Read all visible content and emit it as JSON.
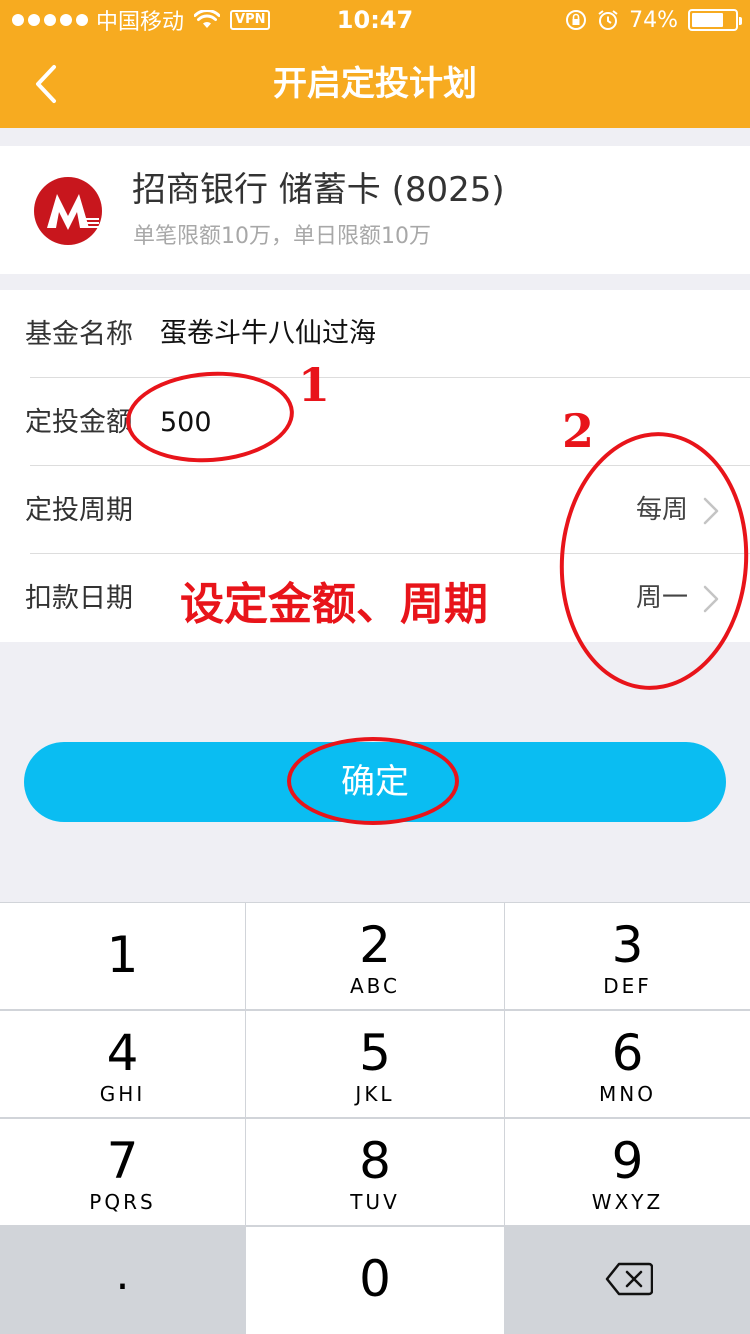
{
  "status_bar": {
    "carrier": "中国移动",
    "vpn": "VPN",
    "time": "10:47",
    "battery_pct": "74%",
    "battery_level": 0.74
  },
  "nav": {
    "title": "开启定投计划",
    "back_icon": "chevron-left-icon"
  },
  "bank": {
    "name": "招商银行 储蓄卡 (8025)",
    "limit": "单笔限额10万，单日限额10万",
    "logo_color": "#c8161d"
  },
  "form": {
    "fund_label": "基金名称",
    "fund_value": "蛋卷斗牛八仙过海",
    "amount_label": "定投金额",
    "amount_value": "500",
    "cycle_label": "定投周期",
    "cycle_value": "每周",
    "date_label": "扣款日期",
    "date_value": "周一"
  },
  "annotations": {
    "num1": "1",
    "num2": "2",
    "note": "设定金额、周期",
    "color": "#e8141a"
  },
  "confirm": {
    "label": "确定",
    "color": "#0abdf2"
  },
  "keypad": {
    "keys": [
      {
        "num": "1",
        "letters": ""
      },
      {
        "num": "2",
        "letters": "ABC"
      },
      {
        "num": "3",
        "letters": "DEF"
      },
      {
        "num": "4",
        "letters": "GHI"
      },
      {
        "num": "5",
        "letters": "JKL"
      },
      {
        "num": "6",
        "letters": "MNO"
      },
      {
        "num": "7",
        "letters": "PQRS"
      },
      {
        "num": "8",
        "letters": "TUV"
      },
      {
        "num": "9",
        "letters": "WXYZ"
      }
    ],
    "dot": ".",
    "zero": "0",
    "delete_icon": "backspace-icon"
  },
  "colors": {
    "header": "#f7ab20",
    "background": "#efeff4"
  }
}
